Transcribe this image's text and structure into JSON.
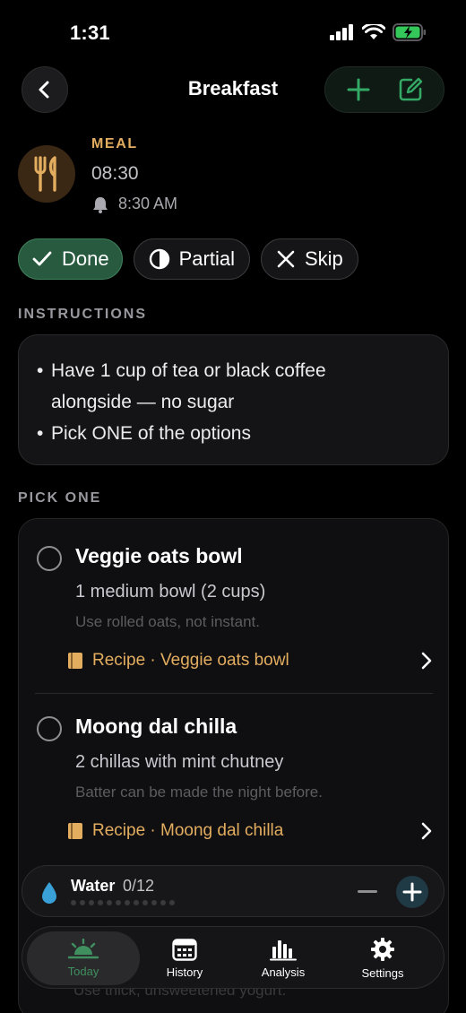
{
  "status_bar": {
    "time": "1:31"
  },
  "nav": {
    "title": "Breakfast",
    "icons": [
      "chevron-left-icon",
      "plus-icon",
      "edit-icon"
    ]
  },
  "meal": {
    "kind": "MEAL",
    "time": "08:30",
    "reminder": "8:30 AM",
    "icon": "fork-knife-icon",
    "accent_color": "#e3ad60"
  },
  "actions": {
    "done": "Done",
    "partial": "Partial",
    "skip": "Skip",
    "done_color": "#285a3f"
  },
  "instructions": {
    "label": "INSTRUCTIONS",
    "items": [
      "Have 1 cup of tea or black coffee",
      "alongside — no sugar",
      "Pick ONE of the options"
    ]
  },
  "pick_one": {
    "label": "PICK ONE",
    "options": [
      {
        "title": "Veggie oats bowl",
        "amount": "1 medium bowl (2 cups)",
        "note": "Use rolled oats, not instant.",
        "recipe": "Recipe · Veggie oats bowl"
      },
      {
        "title": "Moong dal chilla",
        "amount": "2 chillas with mint chutney",
        "note": "Batter can be made the night before.",
        "recipe": "Recipe · Moong dal chilla"
      }
    ],
    "hidden_note": "Use thick, unsweetened yogurt."
  },
  "water": {
    "label": "Water",
    "count": "0/12",
    "consumed": 0,
    "goal": 12,
    "color": "#3aa0d8"
  },
  "tabs": [
    {
      "label": "Today",
      "icon": "sunrise-icon",
      "active": true
    },
    {
      "label": "History",
      "icon": "calendar-icon",
      "active": false
    },
    {
      "label": "Analysis",
      "icon": "bar-chart-icon",
      "active": false
    },
    {
      "label": "Settings",
      "icon": "gear-icon",
      "active": false
    }
  ]
}
